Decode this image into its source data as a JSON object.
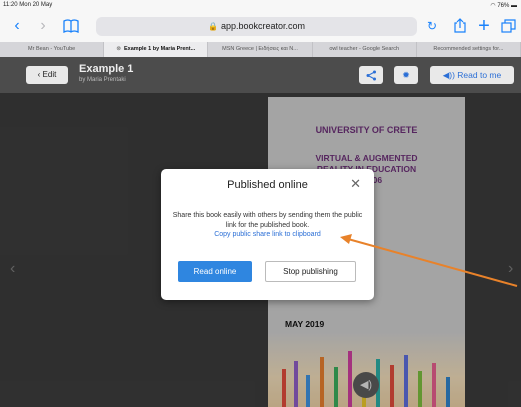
{
  "status_bar": {
    "time": "11:20  Mon 20 May",
    "battery": "76%"
  },
  "toolbar": {
    "url": "app.bookcreator.com",
    "icons": [
      "back-icon",
      "forward-icon",
      "bookmarks-icon",
      "lock-icon",
      "reload-icon",
      "share-icon",
      "new-tab-icon",
      "tabs-icon"
    ]
  },
  "tabs": [
    {
      "label": "Mr Bean - YouTube",
      "active": false
    },
    {
      "label": "Example 1 by Maria Prent...",
      "active": true
    },
    {
      "label": "MSN Greece | Ειδήσεις και N...",
      "active": false
    },
    {
      "label": "owl teacher - Google Search",
      "active": false
    },
    {
      "label": "Recommended settings for...",
      "active": false
    }
  ],
  "header": {
    "edit_label": "Edit",
    "book_title": "Example 1",
    "book_author": "by Maria Prentaki",
    "read_label": "Read to me"
  },
  "cover": {
    "university": "UNIVERSITY OF CRETE",
    "course_line1": "VIRTUAL & AUGMENTED",
    "course_line2": "REALITY IN EDUCATION",
    "course_line3": "2018-06",
    "date": "MAY 2019"
  },
  "modal": {
    "title": "Published online",
    "message": "Share this book easily with others by sending them the public link for the published book.",
    "link": "Copy public share link to clipboard",
    "read_online_label": "Read online",
    "stop_label": "Stop publishing"
  },
  "colors": {
    "accent": "#2f86e0",
    "annotation_arrow": "#e8822a",
    "cover_text": "#6a2f74"
  }
}
